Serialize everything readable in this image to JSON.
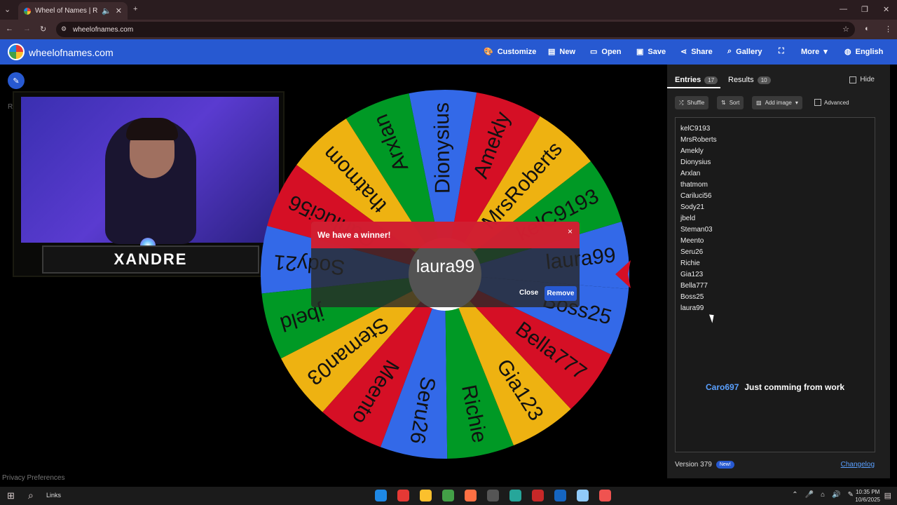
{
  "browser": {
    "tab_title": "Wheel of Names | Random",
    "url": "wheelofnames.com"
  },
  "site": {
    "name": "wheelofnames.com",
    "nav": [
      "Customize",
      "New",
      "Open",
      "Save",
      "Share",
      "Gallery",
      "More",
      "English"
    ]
  },
  "stream": {
    "streamer_name": "XANDRE",
    "cut_label": "R"
  },
  "wheel": {
    "colors": [
      "#3369e8",
      "#009925",
      "#eeb211",
      "#d50f25"
    ],
    "segments": [
      "laura99",
      "kelC9193",
      "MrsRoberts",
      "Amekly",
      "Dionysius",
      "Arxlan",
      "thatmom",
      "Cariluci56",
      "Sody21",
      "jbeld",
      "Steman03",
      "Meento",
      "Seru26",
      "Richie",
      "Gia123",
      "Bella777",
      "Boss25"
    ]
  },
  "modal": {
    "title": "We have a winner!",
    "winner": "laura99",
    "close_label": "Close",
    "remove_label": "Remove",
    "x_label": "×"
  },
  "panel": {
    "entries_label": "Entries",
    "entries_count": "17",
    "results_label": "Results",
    "results_count": "10",
    "hide_label": "Hide",
    "shuffle_label": "Shuffle",
    "sort_label": "Sort",
    "add_image_label": "Add image",
    "advanced_label": "Advanced",
    "entries": [
      "kelC9193",
      "MrsRoberts",
      "Amekly",
      "Dionysius",
      "Arxlan",
      "thatmom",
      "Cariluci56",
      "Sody21",
      "jbeld",
      "Steman03",
      "Meento",
      "Seru26",
      "Richie",
      "Gia123",
      "Bella777",
      "Boss25",
      "laura99"
    ],
    "chat_user": "Caro697",
    "chat_message": "Just comming from work",
    "version": "Version 379",
    "new_badge": "New!",
    "changelog": "Changelog"
  },
  "footer": {
    "privacy": "Privacy Preferences"
  },
  "taskbar": {
    "search_label": "Links",
    "time": "10:35 PM",
    "date": "10/6/2025",
    "apps": [
      "#1e88e5",
      "#e53935",
      "#fbc02d",
      "#43a047",
      "#ff7043",
      "#555555",
      "#26a69a",
      "#c62828",
      "#1565c0",
      "#90caf9",
      "#ef5350"
    ]
  }
}
